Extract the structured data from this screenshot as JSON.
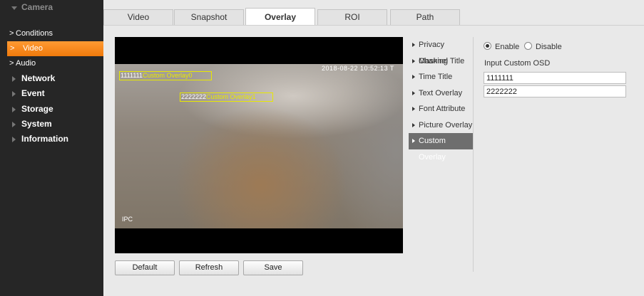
{
  "sidebar": {
    "items": [
      {
        "label": "Camera",
        "type": "main",
        "open": true
      },
      {
        "label": "Conditions",
        "type": "sub"
      },
      {
        "label": "Video",
        "type": "sub",
        "active": true
      },
      {
        "label": "Audio",
        "type": "sub"
      },
      {
        "label": "Network",
        "type": "main"
      },
      {
        "label": "Event",
        "type": "main"
      },
      {
        "label": "Storage",
        "type": "main"
      },
      {
        "label": "System",
        "type": "main"
      },
      {
        "label": "Information",
        "type": "main"
      }
    ],
    "chevron": ">"
  },
  "tabs": [
    {
      "label": "Video"
    },
    {
      "label": "Snapshot"
    },
    {
      "label": "Overlay",
      "active": true
    },
    {
      "label": "ROI"
    },
    {
      "label": "Path"
    }
  ],
  "preview": {
    "overlay0_value": "1111111",
    "overlay0_label": "Custom Overlay0",
    "overlay1_value": "2222222",
    "overlay1_label": "Custom Overlay1",
    "time_title": "2018-08-22 10:52:13 T",
    "channel_title": "IPC"
  },
  "buttons": {
    "default_label": "Default",
    "refresh_label": "Refresh",
    "save_label": "Save"
  },
  "overlay_menu": [
    {
      "label": "Privacy Masking"
    },
    {
      "label": "Channel Title"
    },
    {
      "label": "Time Title"
    },
    {
      "label": "Text Overlay"
    },
    {
      "label": "Font Attribute"
    },
    {
      "label": "Picture Overlay"
    },
    {
      "label": "Custom Overlay",
      "active": true
    }
  ],
  "custom_overlay": {
    "enable_label": "Enable",
    "disable_label": "Disable",
    "selected": "Enable",
    "input_label": "Input Custom OSD",
    "osd_values": [
      "1111111",
      "2222222"
    ]
  },
  "colors": {
    "sidebar_bg": "#262626",
    "active_orange": "#f08a1c",
    "osd_yellow": "#e8e800",
    "menu_active": "#6e6e6e"
  }
}
